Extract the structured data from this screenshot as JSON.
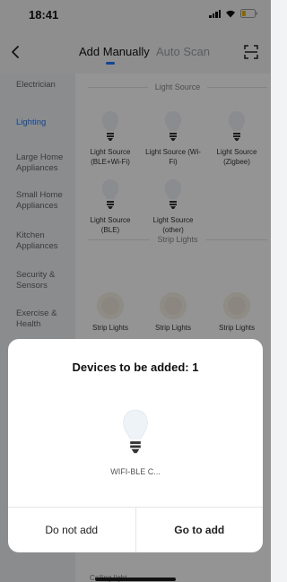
{
  "status": {
    "time": "18:41"
  },
  "tabs": {
    "manual": "Add Manually",
    "scan": "Auto Scan"
  },
  "sidebar": {
    "items": [
      {
        "label": "Electrician"
      },
      {
        "label": "Lighting"
      },
      {
        "label": "Large Home Appliances"
      },
      {
        "label": "Small Home Appliances"
      },
      {
        "label": "Kitchen Appliances"
      },
      {
        "label": "Security & Sensors"
      },
      {
        "label": "Exercise & Health"
      }
    ]
  },
  "sections": {
    "light_source": "Light Source",
    "strip_lights": "Strip Lights"
  },
  "devices": {
    "light_source": [
      {
        "label": "Light Source (BLE+Wi-Fi)"
      },
      {
        "label": "Light Source (Wi-Fi)"
      },
      {
        "label": "Light Source (Zigbee)"
      },
      {
        "label": "Light Source (BLE)"
      },
      {
        "label": "Light Source (other)"
      }
    ],
    "strip_lights": [
      {
        "label": "Strip Lights"
      },
      {
        "label": "Strip Lights"
      },
      {
        "label": "Strip Lights"
      }
    ]
  },
  "dialog": {
    "title": "Devices to be added: 1",
    "device_name": "WIFI-BLE C...",
    "cancel_label": "Do not add",
    "confirm_label": "Go to add"
  },
  "bottom": {
    "peek_label": "Ceiling light"
  },
  "colors": {
    "accent": "#1e78ff",
    "overlay": "rgba(0,0,0,0.42)"
  }
}
